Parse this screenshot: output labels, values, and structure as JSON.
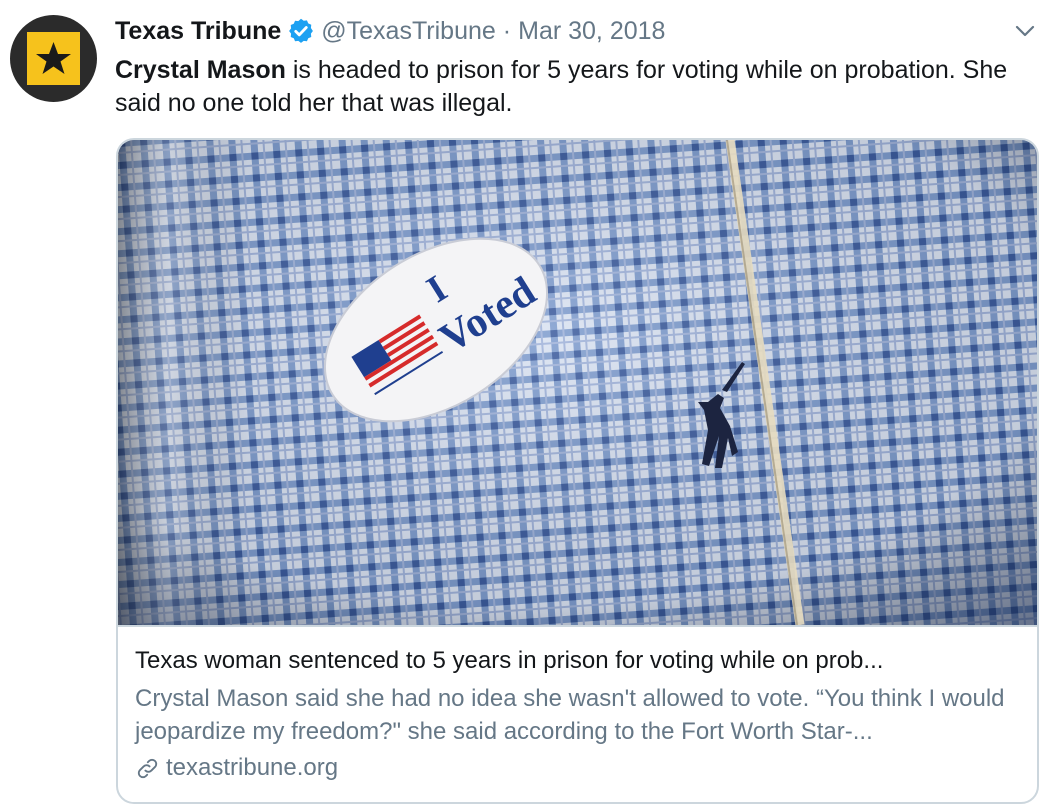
{
  "tweet": {
    "author_name": "Texas Tribune",
    "handle": "@TexasTribune",
    "separator": "·",
    "date": "Mar 30, 2018",
    "text_bold": "Crystal Mason",
    "text_rest": " is headed to prison for 5 years for voting while on probation. She said no one told her that was illegal."
  },
  "card": {
    "image_icon": "i-voted-sticker-photo",
    "sticker_text_1": "I",
    "sticker_text_2": "Voted",
    "title": "Texas woman sentenced to 5 years in prison for voting while on prob...",
    "description": "Crystal Mason said she had no idea she wasn't allowed to vote. “You think I would jeopardize my freedom?\" she said according to the Fort Worth Star-...",
    "domain": "texastribune.org"
  },
  "icons": {
    "verified": "verified-badge-icon",
    "caret": "chevron-down-icon",
    "link": "link-icon"
  },
  "colors": {
    "brand_yellow": "#f6c21c",
    "verified_blue": "#1da1f2",
    "muted": "#657786"
  }
}
